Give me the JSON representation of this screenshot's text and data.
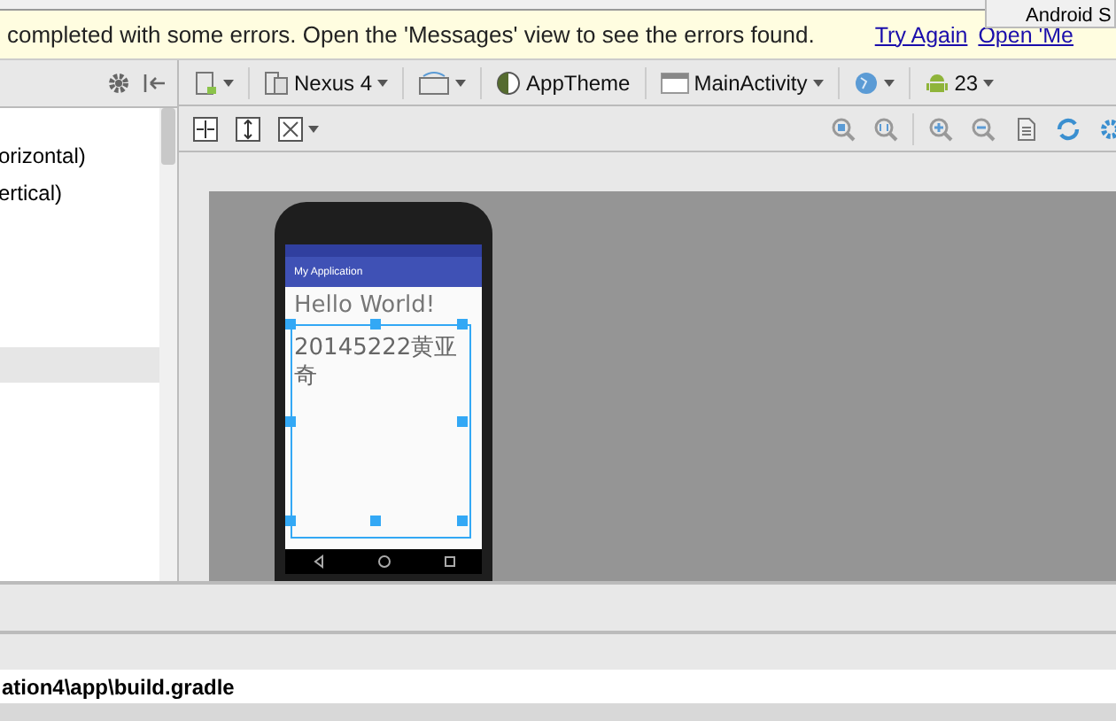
{
  "notification": {
    "message": "completed with some errors. Open the 'Messages' view to see the errors found.",
    "links": [
      "Try Again",
      "Open 'Me"
    ]
  },
  "popup": {
    "title": "Android S"
  },
  "toolbar": {
    "device": "Nexus 4",
    "theme": "AppTheme",
    "activity": "MainActivity",
    "api": "23"
  },
  "palette": {
    "items": [
      {
        "label": "orizontal)"
      },
      {
        "label": "ertical)"
      }
    ]
  },
  "preview": {
    "app_title": "My Application",
    "texts": [
      "Hello World!",
      "20145222黄亚奇"
    ]
  },
  "path_bar": {
    "path": "ation4\\app\\build.gradle"
  }
}
